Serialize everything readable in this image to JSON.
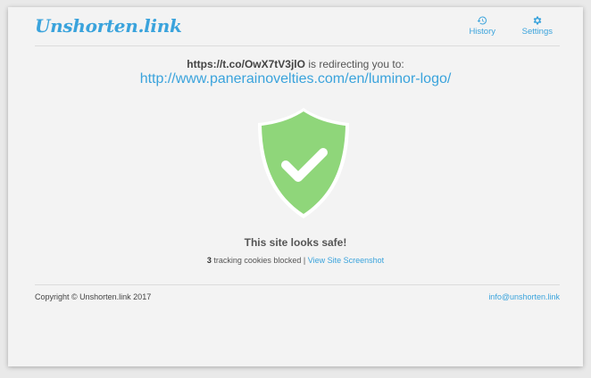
{
  "brand": {
    "logo": "Unshorten.link"
  },
  "nav": {
    "history_label": "History",
    "history_icon": "history-icon",
    "settings_label": "Settings",
    "settings_icon": "gear-icon"
  },
  "redirect": {
    "short_url": "https://t.co/OwX7tV3jlO",
    "message": " is redirecting you to:",
    "destination": "http://www.panerainovelties.com/en/luminor-logo/"
  },
  "result": {
    "status": "This site looks safe!",
    "status_icon": "shield-check-icon",
    "tracking_count": "3",
    "tracking_text": " tracking cookies blocked | ",
    "screenshot_link": "View Site Screenshot"
  },
  "footer": {
    "copyright": "Copyright © Unshorten.link 2017",
    "email": "info@unshorten.link"
  },
  "colors": {
    "accent": "#3aa3dc",
    "safe_green": "#8fd67a",
    "background": "#f3f3f3"
  }
}
